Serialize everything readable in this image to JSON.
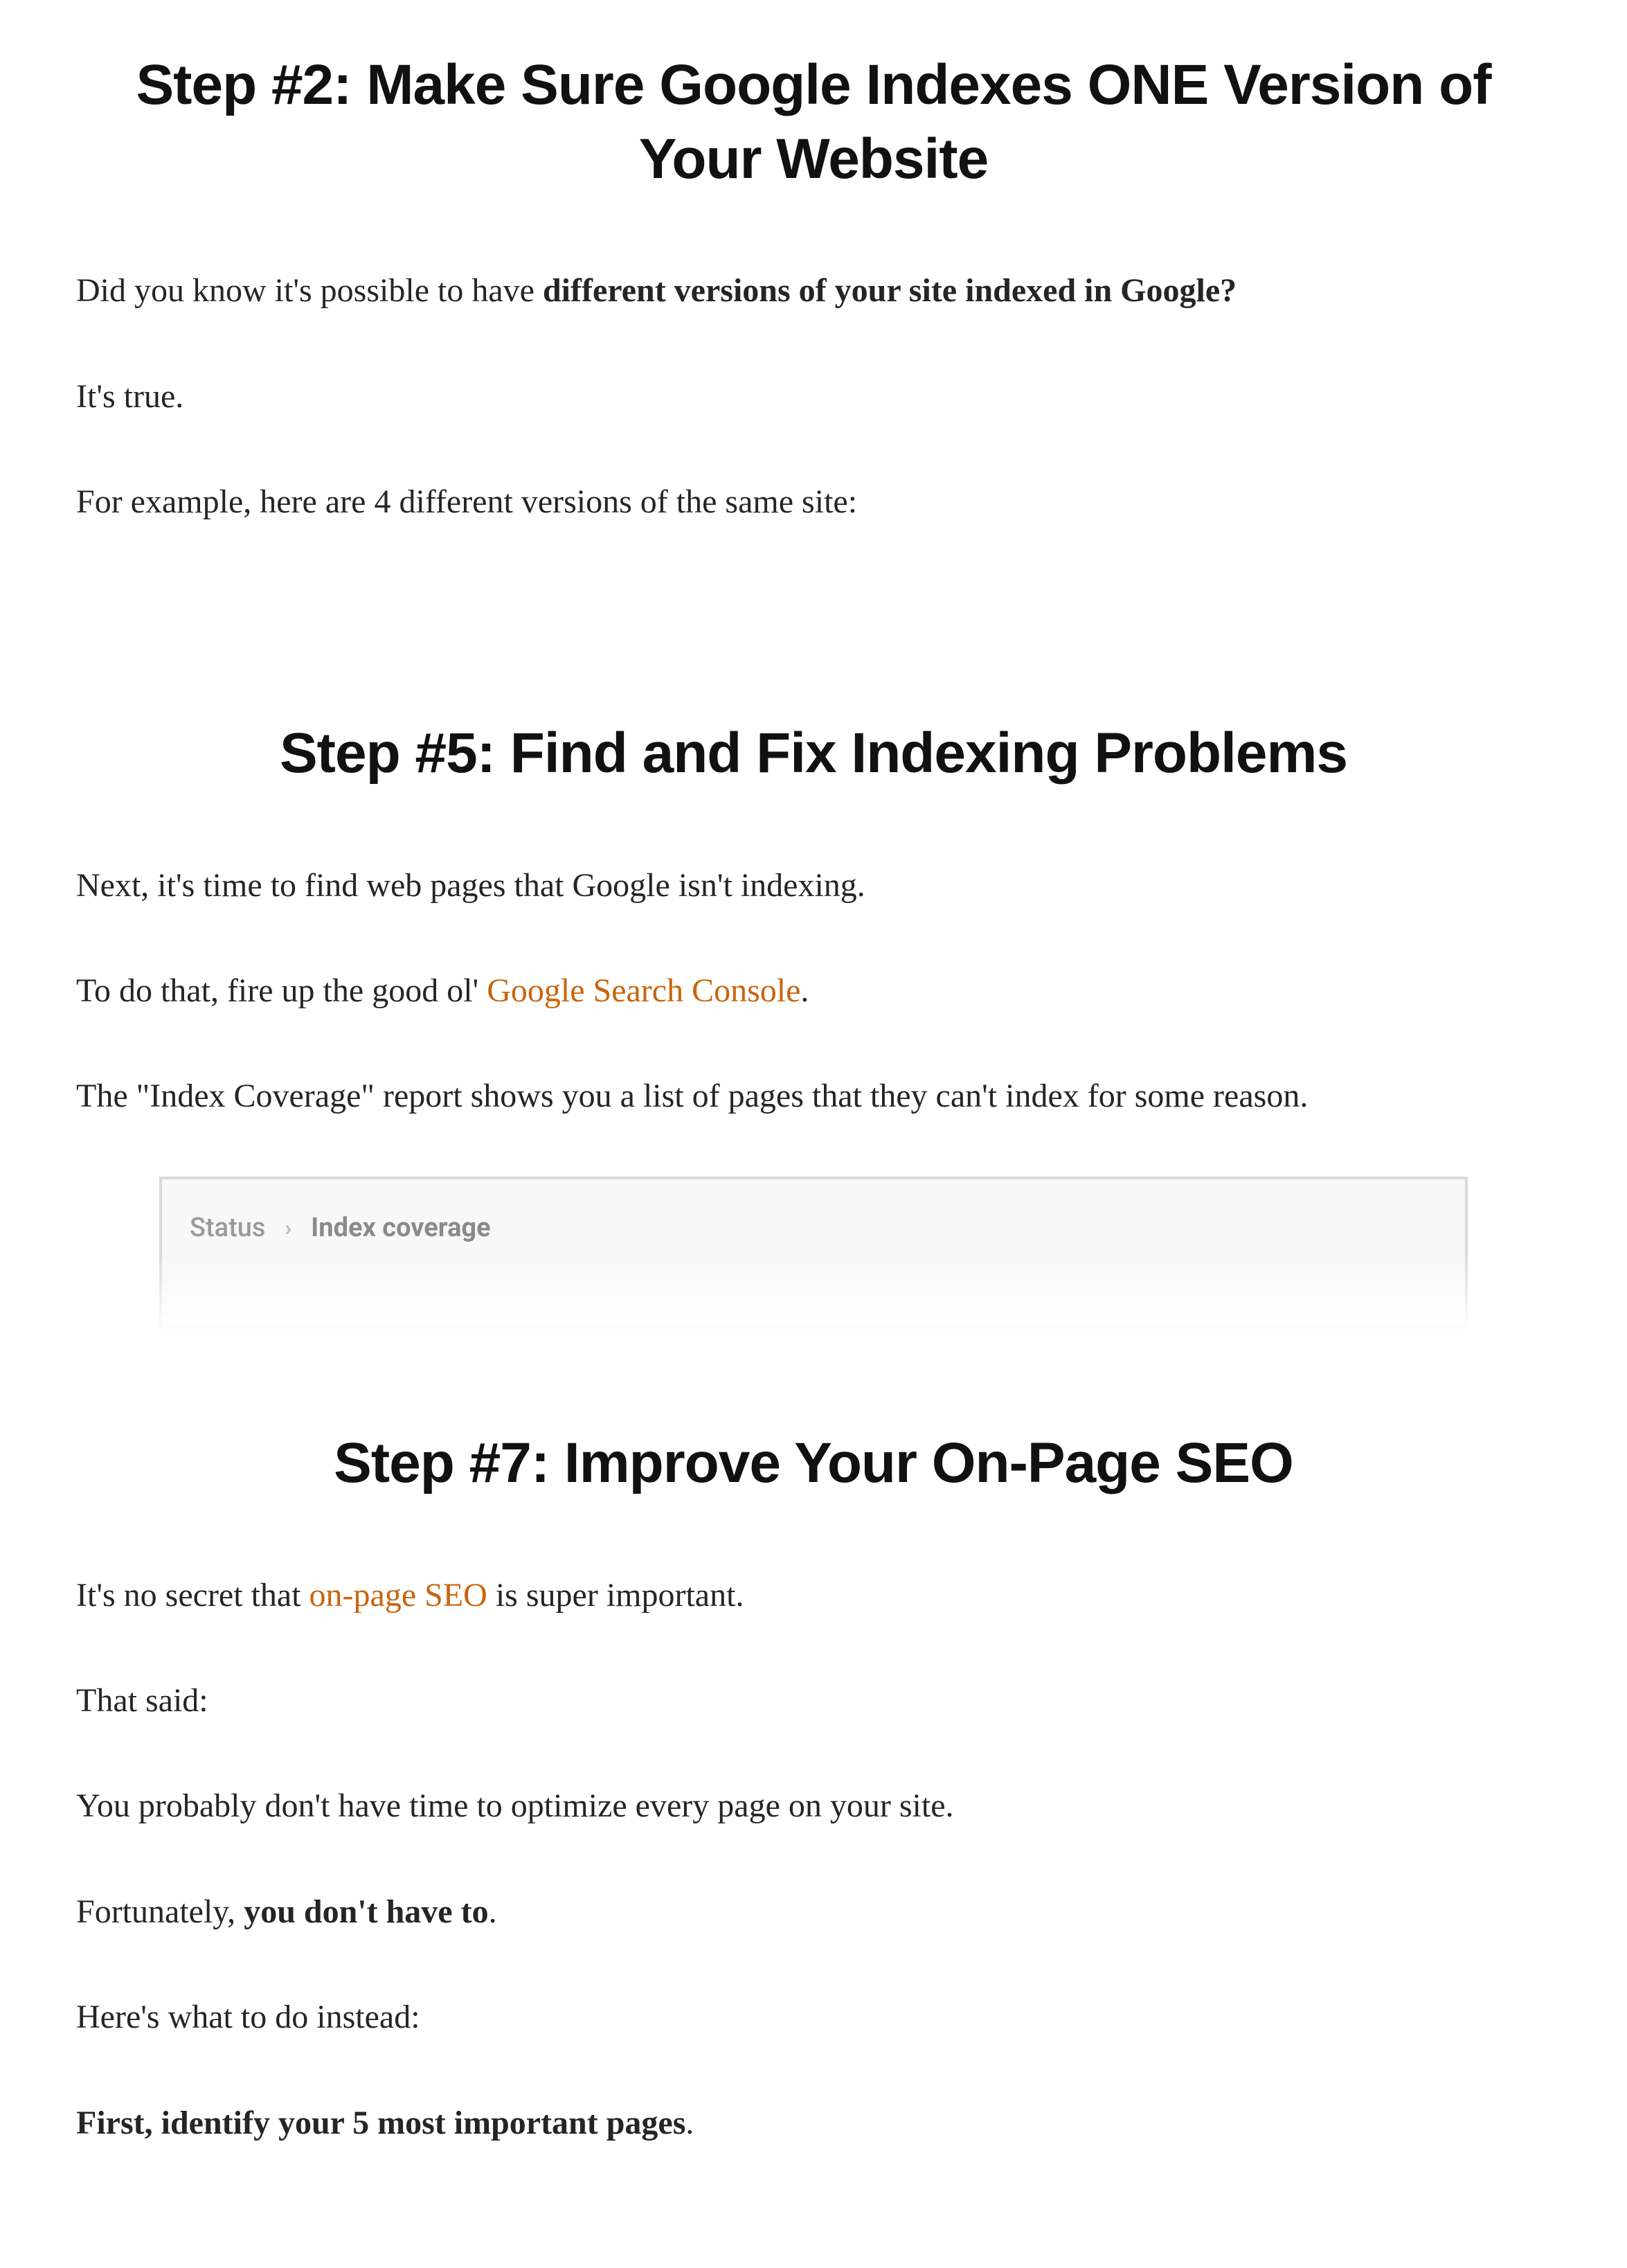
{
  "sections": {
    "step2": {
      "heading": "Step #2: Make Sure Google Indexes ONE Version of Your Website",
      "p1_a": "Did you know it's possible to have ",
      "p1_b": "different versions of your site indexed in Google?",
      "p2": "It's true.",
      "p3": "For example, here are 4 different versions of the same site:"
    },
    "step5": {
      "heading": "Step #5: Find and Fix Indexing Problems",
      "p1": "Next, it's time to find web pages that Google isn't indexing.",
      "p2_a": "To do that, fire up the good ol' ",
      "p2_link": "Google Search Console",
      "p2_b": ".",
      "p3": "The \"Index Coverage\" report shows you a list of pages that they can't index for some reason.",
      "breadcrumb": {
        "item1": "Status",
        "sep": "›",
        "item2": "Index coverage"
      }
    },
    "step7": {
      "heading": "Step #7: Improve Your On-Page SEO",
      "p1_a": "It's no secret that ",
      "p1_link": "on-page SEO",
      "p1_b": " is super important.",
      "p2": "That said:",
      "p3": "You probably don't have time to optimize every page on your site.",
      "p4_a": "Fortunately, ",
      "p4_b": "you don't have to",
      "p4_c": ".",
      "p5": "Here's what to do instead:",
      "p6_a": "First, identify your 5 most important pages",
      "p6_b": "."
    }
  },
  "colors": {
    "link": "#c9640c",
    "heading": "#111111",
    "body": "#252525"
  }
}
